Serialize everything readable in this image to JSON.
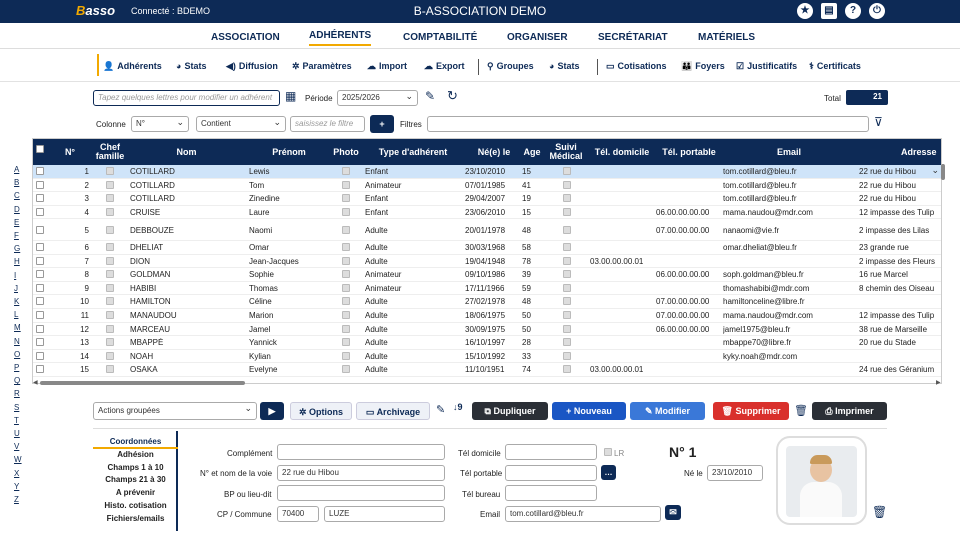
{
  "topbar": {
    "logo_b": "B",
    "logo_rest": "asso",
    "connected": "Connecté : BDEMO",
    "title": "B-ASSOCIATION DEMO"
  },
  "mainnav": [
    "ASSOCIATION",
    "ADHÉRENTS",
    "COMPTABILITÉ",
    "ORGANISER",
    "SECRÉTARIAT",
    "MATÉRIELS"
  ],
  "subnav": {
    "adherents": "Adhérents",
    "stats1": "Stats",
    "diffusion": "Diffusion",
    "parametres": "Paramètres",
    "import": "Import",
    "export": "Export",
    "groupes": "Groupes",
    "stats2": "Stats",
    "cotisations": "Cotisations",
    "foyers": "Foyers",
    "justificatifs": "Justificatifs",
    "certificats": "Certificats"
  },
  "filters": {
    "search_placeholder": "Tapez quelques lettres pour modifier un adhérent",
    "periode_label": "Période",
    "periode": "2025/2026",
    "total_label": "Total",
    "total": "21",
    "colonne_label": "Colonne",
    "colonne": "N°",
    "mode": "Contient",
    "filter_placeholder": "saisissez le filtre",
    "filtres_label": "Filtres"
  },
  "columns": {
    "num": "N°",
    "chef": "Chef famille",
    "nom": "Nom",
    "prenom": "Prénom",
    "photo": "Photo",
    "type": "Type d'adhérent",
    "ne": "Né(e) le",
    "age": "Age",
    "suivi": "Suivi Médical",
    "teldom": "Tél. domicile",
    "telport": "Tél. portable",
    "email": "Email",
    "adresse": "Adresse"
  },
  "rows": [
    {
      "n": "1",
      "nom": "COTILLARD",
      "prenom": "Lewis",
      "type": "Enfant",
      "ne": "23/10/2010",
      "age": "15",
      "teldom": "",
      "telport": "",
      "email": "tom.cotillard@bleu.fr",
      "adresse": "22 rue du Hibou"
    },
    {
      "n": "2",
      "nom": "COTILLARD",
      "prenom": "Tom",
      "type": "Animateur",
      "ne": "07/01/1985",
      "age": "41",
      "teldom": "",
      "telport": "",
      "email": "tom.cotillard@bleu.fr",
      "adresse": "22 rue du Hibou"
    },
    {
      "n": "3",
      "nom": "COTILLARD",
      "prenom": "Zinedine",
      "type": "Enfant",
      "ne": "29/04/2007",
      "age": "19",
      "teldom": "",
      "telport": "",
      "email": "tom.cotillard@bleu.fr",
      "adresse": "22 rue du Hibou"
    },
    {
      "n": "4",
      "nom": "CRUISE",
      "prenom": "Laure",
      "type": "Enfant",
      "ne": "23/06/2010",
      "age": "15",
      "teldom": "",
      "telport": "06.00.00.00.00",
      "email": "mama.naudou@mdr.com",
      "adresse": "12 impasse des Tulip"
    },
    {
      "n": "5",
      "nom": "DEBBOUZE",
      "prenom": "Naomi",
      "type": "Adulte",
      "ne": "20/01/1978",
      "age": "48",
      "teldom": "",
      "telport": "07.00.00.00.00",
      "email": "nanaomi@vie.fr",
      "adresse": "2 impasse des Lilas"
    },
    {
      "n": "6",
      "nom": "DHELIAT",
      "prenom": "Omar",
      "type": "Adulte",
      "ne": "30/03/1968",
      "age": "58",
      "teldom": "",
      "telport": "",
      "email": "omar.dheliat@bleu.fr",
      "adresse": "23 grande rue"
    },
    {
      "n": "7",
      "nom": "DION",
      "prenom": "Jean-Jacques",
      "type": "Adulte",
      "ne": "19/04/1948",
      "age": "78",
      "teldom": "03.00.00.00.01",
      "telport": "",
      "email": "",
      "adresse": "2 impasse des Fleurs"
    },
    {
      "n": "8",
      "nom": "GOLDMAN",
      "prenom": "Sophie",
      "type": "Animateur",
      "ne": "09/10/1986",
      "age": "39",
      "teldom": "",
      "telport": "06.00.00.00.00",
      "email": "soph.goldman@bleu.fr",
      "adresse": "16 rue Marcel"
    },
    {
      "n": "9",
      "nom": "HABIBI",
      "prenom": "Thomas",
      "type": "Animateur",
      "ne": "17/11/1966",
      "age": "59",
      "teldom": "",
      "telport": "",
      "email": "thomashabibi@mdr.com",
      "adresse": "8 chemin des Oiseau"
    },
    {
      "n": "10",
      "nom": "HAMILTON",
      "prenom": "Céline",
      "type": "Adulte",
      "ne": "27/02/1978",
      "age": "48",
      "teldom": "",
      "telport": "07.00.00.00.00",
      "email": "hamiltonceline@libre.fr",
      "adresse": ""
    },
    {
      "n": "11",
      "nom": "MANAUDOU",
      "prenom": "Marion",
      "type": "Adulte",
      "ne": "18/06/1975",
      "age": "50",
      "teldom": "",
      "telport": "07.00.00.00.00",
      "email": "mama.naudou@mdr.com",
      "adresse": "12 impasse des Tulip"
    },
    {
      "n": "12",
      "nom": "MARCEAU",
      "prenom": "Jamel",
      "type": "Adulte",
      "ne": "30/09/1975",
      "age": "50",
      "teldom": "",
      "telport": "06.00.00.00.00",
      "email": "jamel1975@bleu.fr",
      "adresse": "38 rue de Marseille"
    },
    {
      "n": "13",
      "nom": "MBAPPÉ",
      "prenom": "Yannick",
      "type": "Adulte",
      "ne": "16/10/1997",
      "age": "28",
      "teldom": "",
      "telport": "",
      "email": "mbappe70@libre.fr",
      "adresse": "20 rue du Stade"
    },
    {
      "n": "14",
      "nom": "NOAH",
      "prenom": "Kylian",
      "type": "Adulte",
      "ne": "15/10/1992",
      "age": "33",
      "teldom": "",
      "telport": "",
      "email": "kyky.noah@mdr.com",
      "adresse": ""
    },
    {
      "n": "15",
      "nom": "OSAKA",
      "prenom": "Evelyne",
      "type": "Adulte",
      "ne": "11/10/1951",
      "age": "74",
      "teldom": "03.00.00.00.01",
      "telport": "",
      "email": "",
      "adresse": "24 rue des Géranium"
    }
  ],
  "letters": [
    "A",
    "B",
    "C",
    "D",
    "E",
    "F",
    "G",
    "H",
    "I",
    "J",
    "K",
    "L",
    "M",
    "N",
    "O",
    "P",
    "Q",
    "R",
    "S",
    "T",
    "U",
    "V",
    "W",
    "X",
    "Y",
    "Z"
  ],
  "actions": {
    "groupees": "Actions groupées",
    "options": "Options",
    "archivage": "Archivage",
    "dupliquer": "Dupliquer",
    "nouveau": "Nouveau",
    "modifier": "Modifier",
    "supprimer": "Supprimer",
    "imprimer": "Imprimer"
  },
  "tabs": [
    "Coordonnées",
    "Adhésion",
    "Champs 1 à 10",
    "Champs 21 à 30",
    "A prévenir",
    "Histo. cotisation",
    "Fichiers/emails"
  ],
  "form": {
    "complement_label": "Complément",
    "complement": "",
    "voie_label": "N° et nom de la voie",
    "voie": "22 rue du Hibou",
    "bp_label": "BP ou lieu-dit",
    "bp": "",
    "cp_label": "CP / Commune",
    "cp": "70400",
    "commune": "LUZE",
    "teldom_label": "Tél domicile",
    "lr_label": "LR",
    "telport_label": "Tél portable",
    "telbureau_label": "Tél bureau",
    "email_label": "Email",
    "email": "tom.cotillard@bleu.fr",
    "numero": "N° 1",
    "ne_label": "Né le",
    "ne": "23/10/2010"
  },
  "colors": {
    "navy": "#0d2a56",
    "accent": "#f2a900",
    "blue": "#1a56c4",
    "red": "#d9302c",
    "selected_row": "#cfe4f9"
  }
}
